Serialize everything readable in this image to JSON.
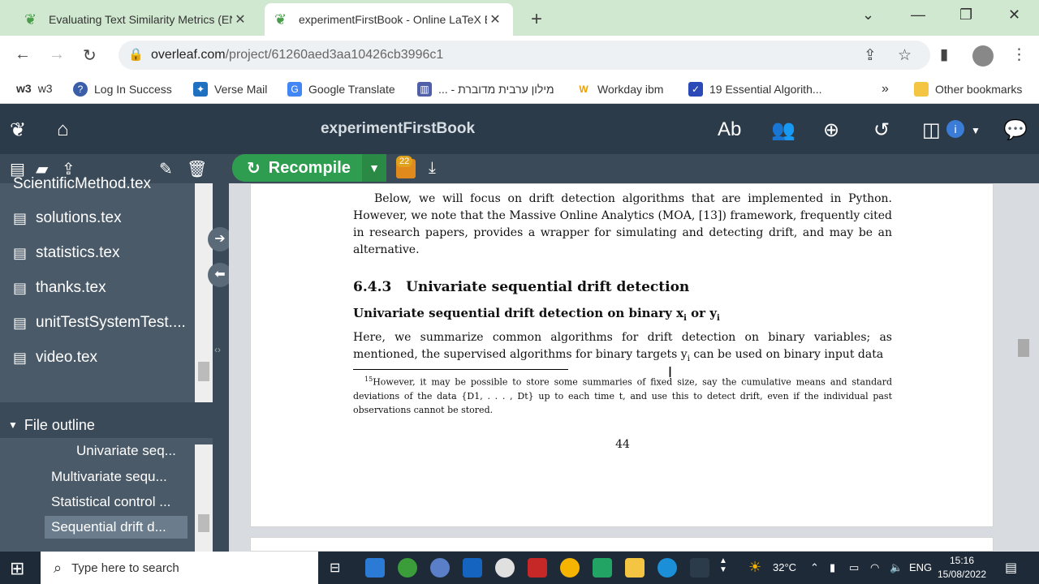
{
  "browser": {
    "tabs": [
      {
        "title": "Evaluating Text Similarity Metrics (EN",
        "active": false
      },
      {
        "title": "experimentFirstBook - Online LaTeX Ed",
        "active": true
      }
    ],
    "url_host": "overleaf.com",
    "url_path": "/project/61260aed3aa10426cb3996c1"
  },
  "bookmarks": [
    {
      "label": "w3",
      "icon_text": "w3"
    },
    {
      "label": "Log In Success"
    },
    {
      "label": "Verse Mail"
    },
    {
      "label": "Google Translate"
    },
    {
      "label": "... - מילון ערבית מדוברת"
    },
    {
      "label": "Workday ibm"
    },
    {
      "label": "19 Essential Algorith..."
    },
    {
      "label": "Other bookmarks"
    }
  ],
  "overleaf": {
    "project_title": "experimentFirstBook",
    "recompile_label": "Recompile",
    "logs_badge": "22"
  },
  "file_tree": [
    "ScientificMethod.tex",
    "solutions.tex",
    "statistics.tex",
    "thanks.tex",
    "unitTestSystemTest....",
    "video.tex"
  ],
  "outline": {
    "header": "File outline",
    "items": [
      "Univariate seq...",
      "Multivariate sequ...",
      "Statistical control ...",
      "Sequential drift d..."
    ]
  },
  "pdf": {
    "para1": "Below, we will focus on drift detection algorithms that are implemented in Python. However, we note that the Massive Online Analytics (MOA, [13]) framework, frequently cited in research papers, provides a wrapper for simulating and detecting drift, and may be an alternative.",
    "section_number": "6.4.3",
    "section_title": "Univariate sequential drift detection",
    "subsection": "Univariate sequential drift detection on binary x",
    "subsection_i": "i",
    "subsection_or": " or y",
    "para2": "Here, we summarize common algorithms for drift detection on binary variables; as mentioned, the supervised algorithms for binary targets y",
    "para2_end": " can be used on binary input data",
    "footnote_mark": "15",
    "footnote": "However, it may be possible to store some summaries of fixed size, say the cumulative means and standard deviations of the data {D1, . . . , Dt} up to each time t, and use this to detect drift, even if the individual past observations cannot be stored.",
    "page_number": "44"
  },
  "taskbar": {
    "search_placeholder": "Type here to search",
    "temperature": "32°C",
    "language": "ENG",
    "time": "15:16",
    "date": "15/08/2022"
  }
}
